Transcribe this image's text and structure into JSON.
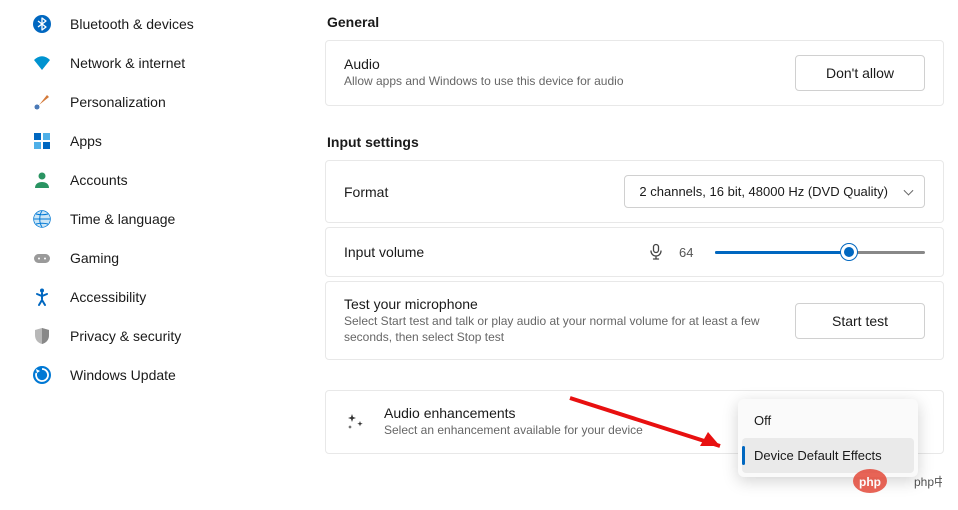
{
  "sidebar": {
    "items": [
      {
        "label": "Bluetooth & devices"
      },
      {
        "label": "Network & internet"
      },
      {
        "label": "Personalization"
      },
      {
        "label": "Apps"
      },
      {
        "label": "Accounts"
      },
      {
        "label": "Time & language"
      },
      {
        "label": "Gaming"
      },
      {
        "label": "Accessibility"
      },
      {
        "label": "Privacy & security"
      },
      {
        "label": "Windows Update"
      }
    ]
  },
  "sections": {
    "general": "General",
    "input": "Input settings"
  },
  "cards": {
    "audio": {
      "title": "Audio",
      "desc": "Allow apps and Windows to use this device for audio",
      "button": "Don't allow"
    },
    "format": {
      "title": "Format",
      "value": "2 channels, 16 bit, 48000 Hz (DVD Quality)"
    },
    "volume": {
      "title": "Input volume",
      "value": 64,
      "percent": 64
    },
    "testmic": {
      "title": "Test your microphone",
      "desc": "Select Start test and talk or play audio at your normal volume for at least a few seconds, then select Stop test",
      "button": "Start test"
    },
    "enhancements": {
      "title": "Audio enhancements",
      "desc": "Select an enhancement available for your device"
    }
  },
  "popup": {
    "off": "Off",
    "default": "Device Default Effects"
  },
  "colors": {
    "accent": "#0067c0"
  },
  "watermark": "php中文网"
}
